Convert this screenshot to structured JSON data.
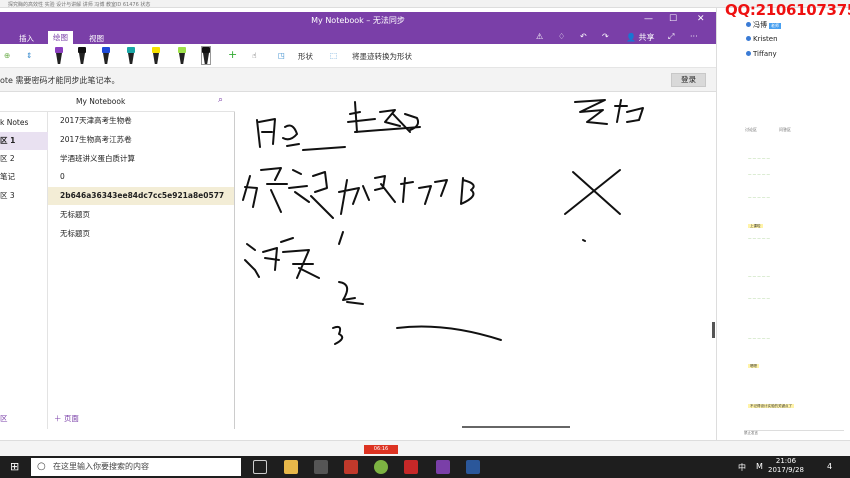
{
  "host": {
    "info": "探究酶的高效性 实验 设计与讲解 讲师 冯博  教室ID 61476 状态"
  },
  "window": {
    "title": "My Notebook – 无法同步",
    "tabs": [
      "插入",
      "绘图",
      "视图"
    ],
    "active_tab": "绘图",
    "share_label": "共享"
  },
  "toolbar": {
    "shapes_label": "形状",
    "ink_to_shape_label": "将墨迹转换为形状"
  },
  "sync": {
    "message": "ote 需要密码才能同步此笔记本。",
    "login_label": "登录"
  },
  "nav": {
    "notebook": "My Notebook",
    "sections": [
      "k Notes",
      "区 1",
      "区 2",
      "笔记",
      "区 3"
    ],
    "active_section": 1,
    "pages": [
      "2017天津高考生物卷",
      "2017生物高考江苏卷",
      "学酒班讲义蛋白质计算",
      "0",
      "2b646a36343ee84dc7cc5e921a8e0577",
      "无标题页",
      "无标题页"
    ],
    "active_page": 4,
    "add_section_label": "区",
    "add_page_label": "页面"
  },
  "right_panel": {
    "qq": "QQ:2106107375",
    "users": [
      {
        "name": "冯博",
        "badge": "老师"
      },
      {
        "name": "Kristen"
      },
      {
        "name": "Tiffany"
      }
    ],
    "chat_tabs": [
      "讨论区",
      "问答区"
    ],
    "chat_highlight_1": "上课啦",
    "chat_highlight_2": "嗯嗯",
    "chat_highlight_3": "不记得设计实验的关键点了",
    "chat_input": "禁止发言"
  },
  "player": {
    "recording": "06:16"
  },
  "taskbar": {
    "search_placeholder": "在这里输入你要搜索的内容",
    "time": "21:06",
    "date": "2017/9/28",
    "ime_lang": "中",
    "ime_mode": "M",
    "notifications": "4"
  }
}
